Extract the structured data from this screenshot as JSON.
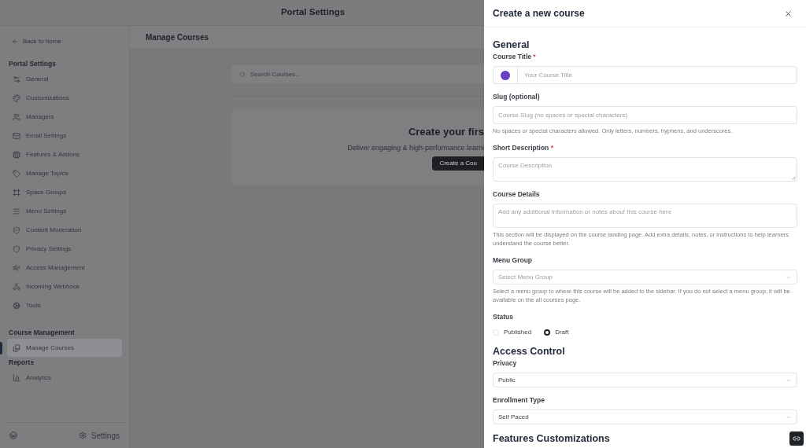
{
  "portal_header": {
    "title": "Portal Settings"
  },
  "sidebar": {
    "back_link": "Back to home",
    "sections": [
      {
        "title": "Portal Settings",
        "items": [
          {
            "label": "General",
            "selected": false
          },
          {
            "label": "Customizations",
            "selected": false
          },
          {
            "label": "Managers",
            "selected": false
          },
          {
            "label": "Email Settings",
            "selected": false
          },
          {
            "label": "Features & Addons",
            "selected": false
          },
          {
            "label": "Manage Topics",
            "selected": false
          },
          {
            "label": "Space Groups",
            "selected": false
          },
          {
            "label": "Menu Settings",
            "selected": false
          },
          {
            "label": "Content Moderation",
            "selected": false
          },
          {
            "label": "Privacy Settings",
            "selected": false
          },
          {
            "label": "Access Management",
            "selected": false
          },
          {
            "label": "Incoming Webhook",
            "selected": false
          },
          {
            "label": "Tools",
            "selected": false
          }
        ]
      },
      {
        "title": "Course Management",
        "items": [
          {
            "label": "Manage Courses",
            "selected": true
          }
        ]
      },
      {
        "title": "Reports",
        "items": [
          {
            "label": "Analytics",
            "selected": false
          }
        ]
      }
    ],
    "footer": {
      "settings_label": "Settings"
    }
  },
  "main": {
    "title": "Manage Courses",
    "search": {
      "placeholder": "Search Courses..."
    },
    "empty_state": {
      "title": "Create your firs",
      "text": "Deliver engaging & high-performance learni",
      "button": "Create a Cou"
    }
  },
  "drawer": {
    "title": "Create a new course",
    "sections": [
      {
        "title": "General",
        "fields": [
          {
            "kind": "color_text",
            "label": "Course Title",
            "required_mark": "*",
            "color": "#6b3fc4",
            "placeholder": "Your Course Title"
          },
          {
            "kind": "text",
            "label": "Slug (optional)",
            "placeholder": "Course Slug (no spaces or special characters)",
            "help": "No spaces or special characters allowed. Only letters, numbers, hyphens, and underscores."
          },
          {
            "kind": "textarea",
            "label": "Short Description",
            "required_mark": "*",
            "resizable": true,
            "placeholder": "Course Description"
          },
          {
            "kind": "textarea",
            "label": "Course Details",
            "resizable": false,
            "placeholder": "Add any additional information or notes about this course here",
            "help": "This section will be displayed on the course landing page. Add extra details, notes, or instructions to help learners understand the course better."
          },
          {
            "kind": "select",
            "label": "Menu Group",
            "placeholder": "Select Menu Group",
            "help": "Select a menu group to where this course will be added to the sidebar. If you do not select a menu group, it will be available on the all courses page."
          },
          {
            "kind": "radio",
            "label": "Status",
            "options": [
              {
                "label": "Published",
                "selected": false
              },
              {
                "label": "Draft",
                "selected": true
              }
            ]
          }
        ]
      },
      {
        "title": "Access Control",
        "fields": [
          {
            "kind": "select",
            "label": "Privacy",
            "value": "Public"
          },
          {
            "kind": "select",
            "label": "Enrollment Type",
            "value": "Self Paced"
          }
        ]
      },
      {
        "title": "Features Customizations"
      }
    ]
  }
}
